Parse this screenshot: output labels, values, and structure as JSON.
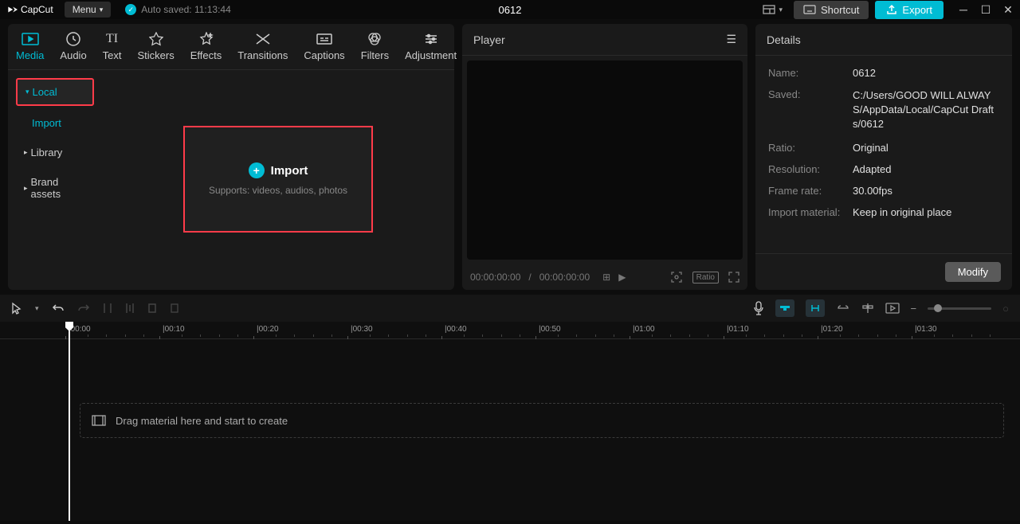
{
  "titlebar": {
    "app_name": "CapCut",
    "menu_label": "Menu",
    "autosave_label": "Auto saved: 11:13:44",
    "project_title": "0612",
    "shortcut_label": "Shortcut",
    "export_label": "Export"
  },
  "tabs": {
    "media": "Media",
    "audio": "Audio",
    "text": "Text",
    "stickers": "Stickers",
    "effects": "Effects",
    "transitions": "Transitions",
    "captions": "Captions",
    "filters": "Filters",
    "adjustment": "Adjustment"
  },
  "sidebar": {
    "local": "Local",
    "import": "Import",
    "library": "Library",
    "brand_assets": "Brand assets"
  },
  "import_box": {
    "label": "Import",
    "sub": "Supports: videos, audios, photos"
  },
  "player": {
    "title": "Player",
    "time_current": "00:00:00:00",
    "time_total": "00:00:00:00",
    "ratio_label": "Ratio"
  },
  "details": {
    "title": "Details",
    "name_label": "Name:",
    "name_value": "0612",
    "saved_label": "Saved:",
    "saved_value": "C:/Users/GOOD WILL ALWAYS/AppData/Local/CapCut Drafts/0612",
    "ratio_label": "Ratio:",
    "ratio_value": "Original",
    "resolution_label": "Resolution:",
    "resolution_value": "Adapted",
    "framerate_label": "Frame rate:",
    "framerate_value": "30.00fps",
    "import_material_label": "Import material:",
    "import_material_value": "Keep in original place",
    "modify_label": "Modify"
  },
  "timeline": {
    "drop_hint": "Drag material here and start to create",
    "ticks": [
      "00:00",
      "00:10",
      "00:20",
      "00:30",
      "00:40",
      "00:50",
      "01:00",
      "01:10",
      "01:20",
      "01:30"
    ]
  }
}
